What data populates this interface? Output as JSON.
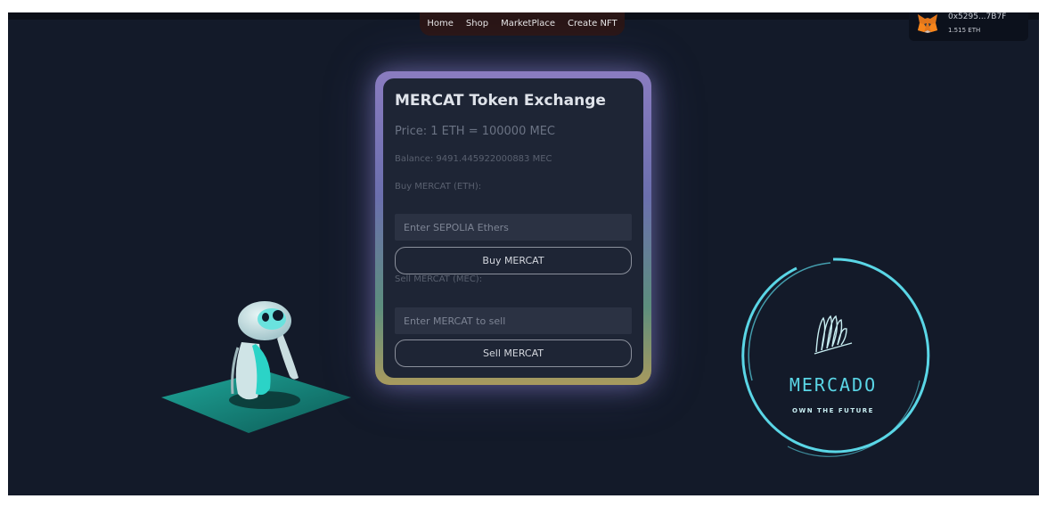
{
  "nav": {
    "items": [
      "Home",
      "Shop",
      "MarketPlace",
      "Create NFT"
    ]
  },
  "wallet": {
    "address": "0x5295...7B7F",
    "balance": "1.515 ETH"
  },
  "exchange": {
    "title": "MERCAT Token Exchange",
    "price": "Price: 1 ETH = 100000 MEC",
    "balance": "Balance: 9491.445922000883 MEC",
    "buy_label": "Buy MERCAT (ETH):",
    "buy_placeholder": "Enter SEPOLIA Ethers",
    "buy_button": "Buy MERCAT",
    "sell_label": "Sell MERCAT (MEC):",
    "sell_placeholder": "Enter MERCAT to sell",
    "sell_button": "Sell MERCAT"
  },
  "brand": {
    "name": "MERCADO",
    "tagline": "OWN THE FUTURE"
  },
  "colors": {
    "background": "#131a29",
    "card": "#1e2535",
    "accent": "#5ad6e6",
    "platform": "#1f8f86"
  }
}
